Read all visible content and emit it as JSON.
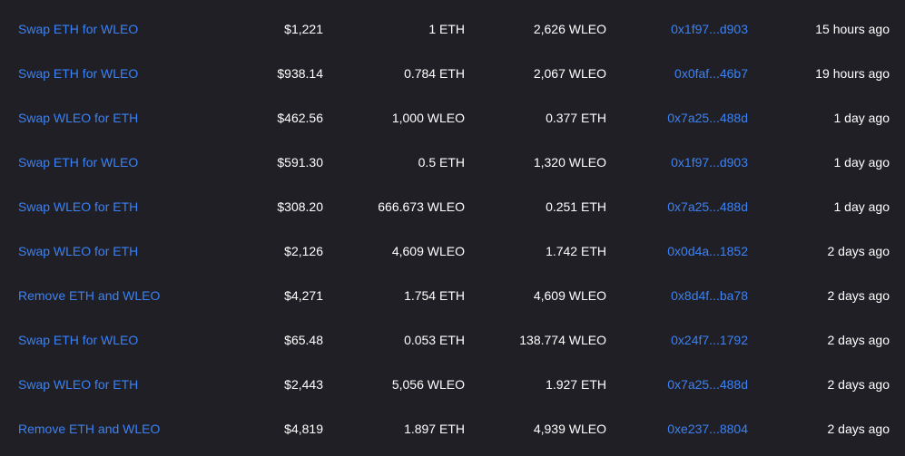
{
  "transactions": {
    "rows": [
      {
        "type": "Swap ETH for WLEO",
        "value": "$1,221",
        "token_amount_0": "1 ETH",
        "token_amount_1": "2,626 WLEO",
        "account": "0x1f97...d903",
        "time": "15 hours ago"
      },
      {
        "type": "Swap ETH for WLEO",
        "value": "$938.14",
        "token_amount_0": "0.784 ETH",
        "token_amount_1": "2,067 WLEO",
        "account": "0x0faf...46b7",
        "time": "19 hours ago"
      },
      {
        "type": "Swap WLEO for ETH",
        "value": "$462.56",
        "token_amount_0": "1,000 WLEO",
        "token_amount_1": "0.377 ETH",
        "account": "0x7a25...488d",
        "time": "1 day ago"
      },
      {
        "type": "Swap ETH for WLEO",
        "value": "$591.30",
        "token_amount_0": "0.5 ETH",
        "token_amount_1": "1,320 WLEO",
        "account": "0x1f97...d903",
        "time": "1 day ago"
      },
      {
        "type": "Swap WLEO for ETH",
        "value": "$308.20",
        "token_amount_0": "666.673 WLEO",
        "token_amount_1": "0.251 ETH",
        "account": "0x7a25...488d",
        "time": "1 day ago"
      },
      {
        "type": "Swap WLEO for ETH",
        "value": "$2,126",
        "token_amount_0": "4,609 WLEO",
        "token_amount_1": "1.742 ETH",
        "account": "0x0d4a...1852",
        "time": "2 days ago"
      },
      {
        "type": "Remove ETH and WLEO",
        "value": "$4,271",
        "token_amount_0": "1.754 ETH",
        "token_amount_1": "4,609 WLEO",
        "account": "0x8d4f...ba78",
        "time": "2 days ago"
      },
      {
        "type": "Swap ETH for WLEO",
        "value": "$65.48",
        "token_amount_0": "0.053 ETH",
        "token_amount_1": "138.774 WLEO",
        "account": "0x24f7...1792",
        "time": "2 days ago"
      },
      {
        "type": "Swap WLEO for ETH",
        "value": "$2,443",
        "token_amount_0": "5,056 WLEO",
        "token_amount_1": "1.927 ETH",
        "account": "0x7a25...488d",
        "time": "2 days ago"
      },
      {
        "type": "Remove ETH and WLEO",
        "value": "$4,819",
        "token_amount_0": "1.897 ETH",
        "token_amount_1": "4,939 WLEO",
        "account": "0xe237...8804",
        "time": "2 days ago"
      }
    ]
  },
  "colors": {
    "background": "#1f1f25",
    "link": "#3b82f6",
    "text": "#ffffff"
  }
}
